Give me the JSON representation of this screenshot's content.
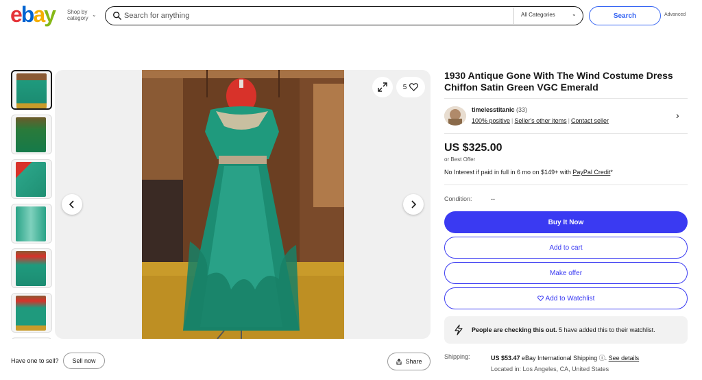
{
  "header": {
    "logo_letters": [
      "e",
      "b",
      "a",
      "y"
    ],
    "logo_colors": [
      "#e53238",
      "#0064d2",
      "#f5af02",
      "#86b817"
    ],
    "shop_by_line1": "Shop by",
    "shop_by_line2": "category",
    "search_placeholder": "Search for anything",
    "category_select": "All Categories",
    "search_button": "Search",
    "advanced_link": "Advanced"
  },
  "gallery": {
    "thumbnail_count": 6,
    "active_thumbnail": 0,
    "watch_count": "5",
    "icons": [
      "expand-icon",
      "heart-icon",
      "chevron-left-icon",
      "chevron-right-icon"
    ]
  },
  "below_image": {
    "sell_prompt": "Have one to sell?",
    "sell_button": "Sell now",
    "share_button": "Share"
  },
  "listing": {
    "title": "1930 Antique Gone With The Wind Costume Dress Chiffon Satin Green VGC Emerald",
    "seller": {
      "name": "timelesstitanic",
      "feedback_count": "(33)",
      "positive": "100% positive",
      "other_items": "Seller's other items",
      "contact": "Contact seller"
    },
    "price": "US $325.00",
    "best_offer": "or Best Offer",
    "financing_text": "No Interest if paid in full in 6 mo on $149+ with ",
    "financing_link": "PayPal Credit",
    "financing_suffix": "*",
    "condition_label": "Condition:",
    "condition_value": "--",
    "buttons": {
      "buy_now": "Buy It Now",
      "add_to_cart": "Add to cart",
      "make_offer": "Make offer",
      "watchlist": "Add to Watchlist"
    },
    "watching": {
      "bold": "People are checking this out.",
      "rest": " 5 have added this to their watchlist."
    },
    "shipping": {
      "label": "Shipping:",
      "price": "US $53.47",
      "method": " eBay International Shipping ",
      "see_details": "See details",
      "location": "Located in: Los Angeles, CA, United States"
    }
  },
  "colors": {
    "accent": "#3a3af2",
    "dress_green": "#1f9a7d",
    "floor_gold": "#c99b2a",
    "wood": "#6b3f22"
  }
}
